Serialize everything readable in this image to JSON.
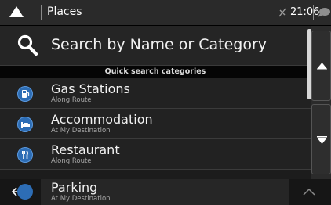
{
  "header": {
    "title": "Places",
    "time": "21:06"
  },
  "search": {
    "label": "Search by Name or Category"
  },
  "categories_header": "Quick search categories",
  "items": [
    {
      "name": "Gas Stations",
      "sub": "Along Route",
      "icon": "gas-pump-icon"
    },
    {
      "name": "Accommodation",
      "sub": "At My Destination",
      "icon": "bed-icon"
    },
    {
      "name": "Restaurant",
      "sub": "Along Route",
      "icon": "fork-knife-icon"
    },
    {
      "name": "Parking",
      "sub": "At My Destination",
      "icon": "parking-icon"
    }
  ],
  "colors": {
    "accent": "#2d6db5",
    "background": "#1c1c1c"
  }
}
